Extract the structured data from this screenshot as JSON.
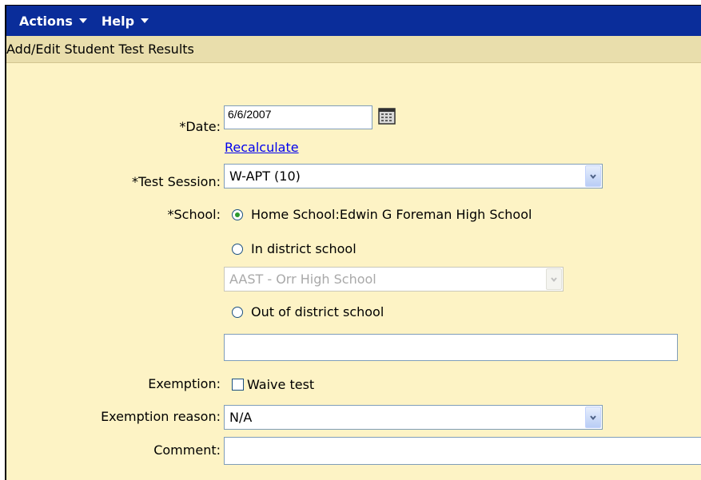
{
  "menubar": {
    "actions_label": "Actions",
    "help_label": "Help"
  },
  "page": {
    "title": "Add/Edit Student Test Results"
  },
  "form": {
    "date_label": "*Date:",
    "date_value": "6/6/2007",
    "recalculate_label": "Recalculate",
    "test_session_label": "*Test Session:",
    "test_session_value": "W-APT (10)",
    "school_label": "*School:",
    "home_school_label": "Home School:Edwin G Foreman High School",
    "in_district_label": "In district school",
    "in_district_select_value": "AAST - Orr High School",
    "out_district_label": "Out of district school",
    "out_district_value": "",
    "exemption_label": "Exemption:",
    "waive_test_label": "Waive test",
    "exemption_reason_label": "Exemption reason:",
    "exemption_reason_value": "N/A",
    "comment_label": "Comment:",
    "comment_value": ""
  },
  "state": {
    "selected_school_option": "home",
    "waive_test_checked": false,
    "in_district_select_disabled": true
  },
  "colors": {
    "menubar_bg": "#0a2d9a",
    "form_bg": "#fdf3c5",
    "titlebar_bg": "#e9deac",
    "link": "#0000ee",
    "radio_selected": "#2b9a2b"
  },
  "icons": {
    "date_picker": "calendar-icon",
    "dropdown": "chevron-down-icon",
    "menu": "triangle-down-icon"
  }
}
